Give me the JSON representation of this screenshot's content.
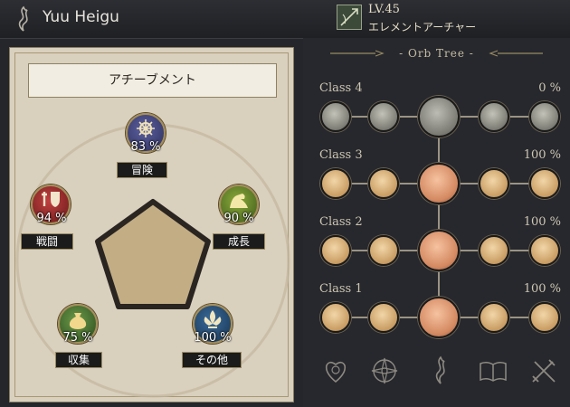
{
  "header": {
    "character_name": "Yuu Heigu",
    "level": "LV.45",
    "class_name": "エレメントアーチャー",
    "emblem_icon": "flame-emblem-icon",
    "class_icon": "element-archer-class-icon"
  },
  "achievements": {
    "title": "アチーブメント",
    "items": [
      {
        "label": "冒険",
        "percent": "83 %",
        "icon": "ships-wheel-icon",
        "color": "#3b3f73"
      },
      {
        "label": "戦闘",
        "percent": "94 %",
        "icon": "sword-shield-icon",
        "color": "#8a2424"
      },
      {
        "label": "成長",
        "percent": "90 %",
        "icon": "flexed-arm-icon",
        "color": "#4f6e22"
      },
      {
        "label": "収集",
        "percent": "75 %",
        "icon": "money-bag-icon",
        "color": "#3d5e2a"
      },
      {
        "label": "その他",
        "percent": "100 %",
        "icon": "fleur-de-lis-icon",
        "color": "#1e4768"
      }
    ]
  },
  "orb_tree": {
    "title": "- Orb Tree -",
    "classes": [
      {
        "label": "Class  4",
        "percent": "0 %",
        "state": "locked"
      },
      {
        "label": "Class  3",
        "percent": "100 %",
        "state": "complete"
      },
      {
        "label": "Class  2",
        "percent": "100 %",
        "state": "complete"
      },
      {
        "label": "Class  1",
        "percent": "100 %",
        "state": "complete"
      }
    ]
  },
  "bottom_icons": [
    "heart-seal-icon",
    "compass-rose-icon",
    "flame-emblem-icon",
    "open-book-icon",
    "crossed-tools-icon"
  ]
}
